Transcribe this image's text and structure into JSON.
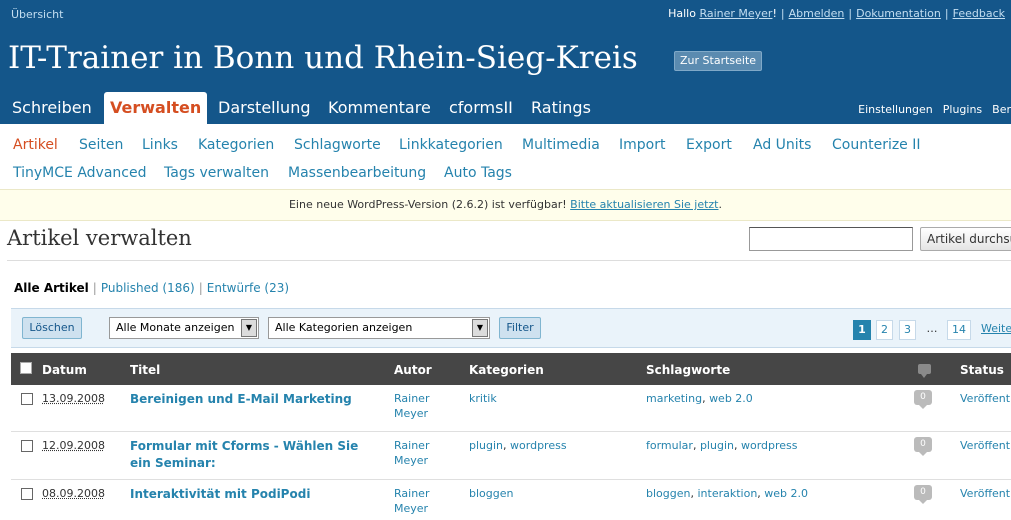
{
  "userbar": {
    "overview": "Übersicht",
    "hello": "Hallo",
    "user": "Rainer Meyer",
    "hello_end": "!",
    "logout": "Abmelden",
    "docs": "Dokumentation",
    "feedback": "Feedback"
  },
  "header": {
    "site_title": "IT-Trainer in Bonn und Rhein-Sieg-Kreis",
    "visit_site": "Zur Startseite"
  },
  "main_nav": [
    "Schreiben",
    "Verwalten",
    "Darstellung",
    "Kommentare",
    "cformsII",
    "Ratings"
  ],
  "side_nav": [
    "Einstellungen",
    "Plugins",
    "Ber"
  ],
  "sub_nav": {
    "row1": [
      "Artikel",
      "Seiten",
      "Links",
      "Kategorien",
      "Schlagworte",
      "Linkkategorien",
      "Multimedia",
      "Import",
      "Export",
      "Ad Units",
      "Counterize II"
    ],
    "row2": [
      "TinyMCE Advanced",
      "Tags verwalten",
      "Massenbearbeitung",
      "Auto Tags"
    ]
  },
  "update_nag": {
    "text": "Eine neue WordPress-Version (2.6.2) ist verfügbar!",
    "link": "Bitte aktualisieren Sie jetzt",
    "end": "."
  },
  "page": {
    "title": "Artikel verwalten",
    "search_value": "",
    "search_button": "Artikel durchsuchen"
  },
  "status_filter": {
    "all": "Alle Artikel",
    "published": "Published (186)",
    "drafts": "Entwürfe (23)"
  },
  "filter_bar": {
    "delete": "Löschen",
    "months": "Alle Monate anzeigen",
    "categories": "Alle Kategorien anzeigen",
    "filter": "Filter",
    "pages": [
      "1",
      "2",
      "3",
      "…",
      "14"
    ],
    "next": "Weiter"
  },
  "table": {
    "headers": {
      "date": "Datum",
      "title": "Titel",
      "author": "Autor",
      "categories": "Kategorien",
      "tags": "Schlagworte",
      "status": "Status"
    },
    "rows": [
      {
        "date": "13.09.2008",
        "title": "Bereinigen und E-Mail Marketing",
        "author": "Rainer Meyer",
        "categories": [
          "kritik"
        ],
        "tags": [
          "marketing",
          "web 2.0"
        ],
        "comments": "0",
        "status": "Veröffentlicht"
      },
      {
        "date": "12.09.2008",
        "title": "Formular mit Cforms - Wählen Sie ein Seminar:",
        "author": "Rainer Meyer",
        "categories": [
          "plugin",
          "wordpress"
        ],
        "tags": [
          "formular",
          "plugin",
          "wordpress"
        ],
        "comments": "0",
        "status": "Veröffentlicht"
      },
      {
        "date": "08.09.2008",
        "title": "Interaktivität mit PodiPodi",
        "author": "Rainer Meyer",
        "categories": [
          "bloggen"
        ],
        "tags": [
          "bloggen",
          "interaktion",
          "web 2.0"
        ],
        "comments": "0",
        "status": "Veröffentlicht"
      }
    ]
  },
  "colors": {
    "header_bg": "#14568a",
    "link": "#2583ad",
    "active": "#d54e21",
    "table_head": "#464646"
  }
}
